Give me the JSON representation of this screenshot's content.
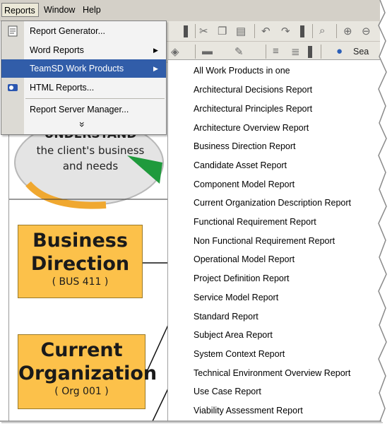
{
  "menubar": {
    "items": [
      {
        "label": "Reports"
      },
      {
        "label": "Window"
      },
      {
        "label": "Help"
      }
    ]
  },
  "reports_menu": {
    "items": [
      {
        "label": "Report Generator...",
        "icon": "document-icon"
      },
      {
        "label": "Word Reports",
        "has_submenu": true
      },
      {
        "label": "TeamSD Work Products",
        "has_submenu": true,
        "highlighted": true
      },
      {
        "label": "HTML Reports...",
        "icon": "html-report-icon"
      },
      {
        "label": "Report Server Manager..."
      }
    ],
    "expand_glyph": "»"
  },
  "work_products_submenu": {
    "items": [
      "All Work Products in one",
      "Architectural Decisions Report",
      "Architectural Principles Report",
      "Architecture Overview Report",
      "Business Direction Report",
      "Candidate Asset Report",
      "Component Model Report",
      "Current Organization Description Report",
      "Functional Requirement Report",
      "Non Functional Requirement Report",
      "Operational Model Report",
      "Project Definition Report",
      "Service Model Report",
      "Standard Report",
      "Subject Area Report",
      "System Context Report",
      "Technical Environment Overview Report",
      "Use Case Report",
      "Viability Assessment Report"
    ]
  },
  "toolbar2": {
    "search_label": "Sea"
  },
  "diagram": {
    "understand": {
      "heading": "UNDERSTAND",
      "line1": "the client's business",
      "line2": "and needs"
    },
    "boxes": [
      {
        "title1": "Business",
        "title2": "Direction",
        "code": "( BUS 411 )"
      },
      {
        "title1": "Current",
        "title2": "Organization",
        "code": "( Org 001 )"
      }
    ]
  },
  "colors": {
    "menu_highlight": "#315da9",
    "box_fill": "#fcc14a",
    "menubar_bg": "#d4d0c8"
  }
}
